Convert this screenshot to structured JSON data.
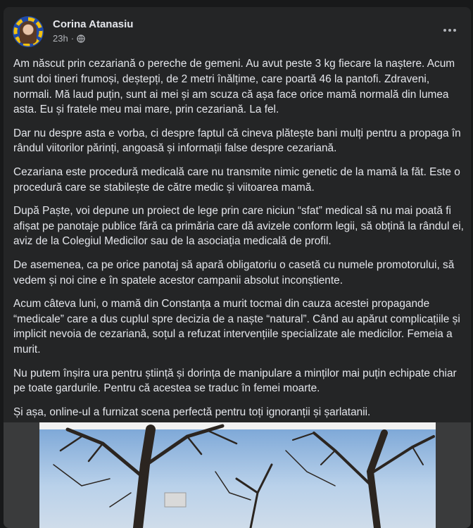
{
  "post": {
    "author": "Corina Atanasiu",
    "time": "23h",
    "separator": "·",
    "paragraphs": [
      "Am născut prin cezariană o pereche de gemeni. Au avut peste 3 kg fiecare la naștere. Acum sunt doi tineri frumoși, deștepți, de 2 metri înălțime, care poartă 46 la pantofi. Zdraveni, normali. Mă laud puțin, sunt ai mei și am scuza că așa face orice mamă normală din lumea asta. Eu și fratele meu mai mare, prin cezariană. La fel.",
      "Dar nu despre asta e vorba, ci despre faptul că cineva plătește bani mulți pentru a propaga în rândul viitorilor părinți, angoasă și informații false despre cezariană.",
      "Cezariana este procedură medicală care nu transmite nimic genetic de la mamă la făt. Este o procedură care se stabilește de către medic și viitoarea mamă.",
      "După Paște, voi depune un proiect de lege prin care niciun “sfat” medical să nu mai poată fi afișat pe panotaje publice fără ca primăria care dă avizele conform legii, să obțină la rândul ei, aviz de la Colegiul Medicilor sau de la asociația medicală de profil.",
      "De asemenea, ca pe orice panotaj să apară obligatoriu o casetă cu numele promotorului, să vedem și noi cine e în spatele acestor campanii absolut inconștiente.",
      "Acum câteva luni, o mamă din Constanța a murit tocmai din cauza acestei propagande “medicale” care a dus cuplul spre decizia de a naște “natural”. Când au apărut complicațiile și implicit nevoia de cezariană, soțul a refuzat intervențiile specializate ale medicilor. Femeia a murit.",
      "Nu putem înșira ura pentru știință și dorința de manipulare a minților mai puțin echipate chiar pe toate gardurile. Pentru că acestea se traduc în femei moarte.",
      "Și așa, online-ul a furnizat scena perfectă pentru toți ignoranții și șarlatanii."
    ]
  },
  "icons": {
    "privacy": "globe-icon",
    "menu": "more-options-icon"
  },
  "colors": {
    "background": "#18191a",
    "card": "#242526",
    "text": "#e4e6eb",
    "secondary": "#b0b3b8"
  }
}
